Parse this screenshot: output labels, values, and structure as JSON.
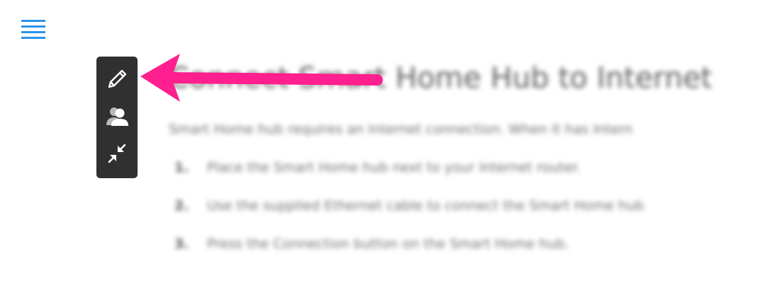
{
  "header": {
    "menu_icon": "hamburger-menu-icon",
    "accent_color": "#2a92e8"
  },
  "article": {
    "title": "Connect Smart Home Hub to Internet",
    "intro": "Smart Home hub requires an Internet connection. When it has Intern",
    "steps": [
      {
        "number": "1.",
        "text": "Place the Smart Home hub next to your Internet router."
      },
      {
        "number": "2.",
        "text": "Use the supplied Ethernet cable to connect the Smart Home hub"
      },
      {
        "number": "3.",
        "text": "Press the Connection button on the Smart Home hub."
      }
    ]
  },
  "toolbar": {
    "background_color": "#303030",
    "tools": [
      {
        "icon": "pencil-icon"
      },
      {
        "icon": "users-icon"
      },
      {
        "icon": "collapse-icon"
      }
    ]
  },
  "annotation": {
    "arrow_color": "#ff1f8e"
  }
}
